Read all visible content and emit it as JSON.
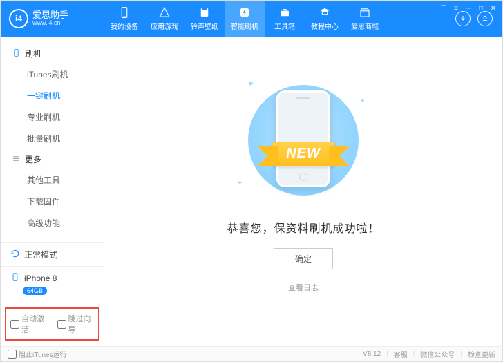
{
  "brand": {
    "logo": "i4",
    "title": "爱思助手",
    "site": "www.i4.cn"
  },
  "nav": [
    {
      "key": "device",
      "label": "我的设备"
    },
    {
      "key": "apps",
      "label": "应用游戏"
    },
    {
      "key": "ring",
      "label": "铃声壁纸"
    },
    {
      "key": "flash",
      "label": "智能刷机",
      "active": true
    },
    {
      "key": "toolbox",
      "label": "工具箱"
    },
    {
      "key": "tutorial",
      "label": "教程中心"
    },
    {
      "key": "store",
      "label": "爱思商城"
    }
  ],
  "sidebar": {
    "group_flash": "刷机",
    "group_more": "更多",
    "items_flash": [
      {
        "key": "itunes",
        "label": "iTunes刷机"
      },
      {
        "key": "onekey",
        "label": "一键刷机",
        "active": true
      },
      {
        "key": "pro",
        "label": "专业刷机"
      },
      {
        "key": "batch",
        "label": "批量刷机"
      }
    ],
    "items_more": [
      {
        "key": "other",
        "label": "其他工具"
      },
      {
        "key": "download",
        "label": "下载固件"
      },
      {
        "key": "advanced",
        "label": "高级功能"
      }
    ],
    "status_mode": "正常模式",
    "device_name": "iPhone 8",
    "device_storage": "64GB",
    "opt_auto_activate": "自动激活",
    "opt_skip_guide": "跳过向导"
  },
  "main": {
    "ribbon": "NEW",
    "success_message": "恭喜您，保资料刷机成功啦！",
    "confirm": "确定",
    "view_log": "查看日志"
  },
  "footer": {
    "block_itunes": "阻止iTunes运行",
    "version": "V8.12",
    "kefu": "客服",
    "wechat": "微信公众号",
    "check_update": "检查更新"
  }
}
